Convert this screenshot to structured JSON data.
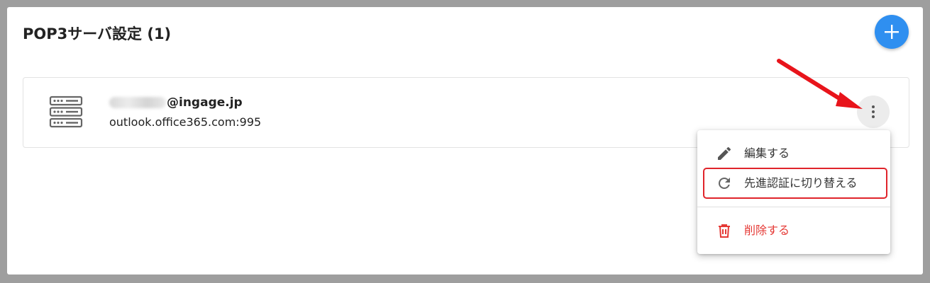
{
  "panel": {
    "title": "POP3サーバ設定 (1)",
    "add_icon": "plus-icon",
    "accent_color": "#2f8ff0"
  },
  "server": {
    "icon": "server-rack-icon",
    "account_domain": "@ingage.jp",
    "host": "outlook.office365.com:995",
    "more_icon": "more-vertical-icon"
  },
  "menu": {
    "items": [
      {
        "label": "編集する",
        "icon": "pencil-icon"
      },
      {
        "label": "先進認証に切り替える",
        "icon": "refresh-icon",
        "highlighted": true
      },
      {
        "label": "削除する",
        "icon": "trash-icon",
        "danger": true
      }
    ],
    "danger_color": "#e53935",
    "highlight_color": "#e0242b"
  },
  "annotation": {
    "arrow_color": "#e8141b",
    "points_to": "more-button"
  }
}
